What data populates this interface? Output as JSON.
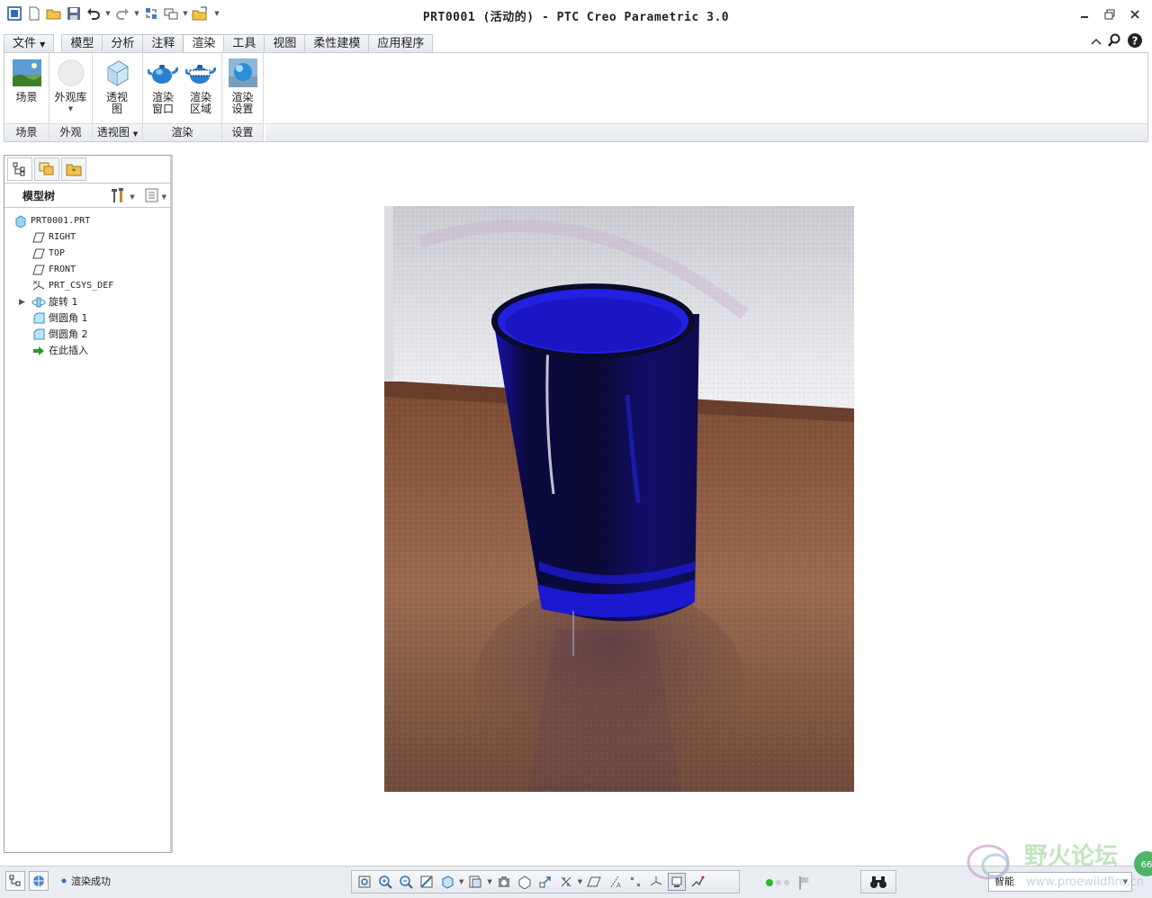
{
  "window": {
    "title": "PRT0001 (活动的) - PTC Creo Parametric 3.0"
  },
  "tabs": [
    {
      "label": "文件",
      "file": true
    },
    {
      "label": "模型"
    },
    {
      "label": "分析"
    },
    {
      "label": "注释"
    },
    {
      "label": "渲染",
      "active": true
    },
    {
      "label": "工具"
    },
    {
      "label": "视图"
    },
    {
      "label": "柔性建模"
    },
    {
      "label": "应用程序"
    }
  ],
  "ribbon": {
    "scene_button": "场景",
    "appearance_button": "外观库",
    "perspective_button_l1": "透视",
    "perspective_button_l2": "图",
    "render_window_l1": "渲染",
    "render_window_l2": "窗口",
    "render_region_l1": "渲染",
    "render_region_l2": "区域",
    "render_settings_l1": "渲染",
    "render_settings_l2": "设置",
    "group_scene": "场景",
    "group_appearance": "外观",
    "group_perspective": "透视图",
    "group_render": "渲染",
    "group_settings": "设置"
  },
  "navigator": {
    "header": "模型树",
    "tree": [
      {
        "label": "PRT0001.PRT",
        "icon": "part-icon",
        "level": 0
      },
      {
        "label": "RIGHT",
        "icon": "datum-plane-icon",
        "level": 1
      },
      {
        "label": "TOP",
        "icon": "datum-plane-icon",
        "level": 1
      },
      {
        "label": "FRONT",
        "icon": "datum-plane-icon",
        "level": 1
      },
      {
        "label": "PRT_CSYS_DEF",
        "icon": "csys-icon",
        "level": 1
      },
      {
        "label": "旋转 1",
        "icon": "revolve-icon",
        "level": 1,
        "expandable": true
      },
      {
        "label": "倒圆角 1",
        "icon": "round-icon",
        "level": 1
      },
      {
        "label": "倒圆角 2",
        "icon": "round-icon",
        "level": 1
      },
      {
        "label": "在此插入",
        "icon": "insert-here-icon",
        "level": 1
      }
    ]
  },
  "status": {
    "message": "渲染成功",
    "filter": "智能"
  },
  "colors": {
    "glass": "#1a17c8",
    "floor": "#8a5a42",
    "wall": "#eceef2",
    "accent": "#2f6fb4"
  }
}
